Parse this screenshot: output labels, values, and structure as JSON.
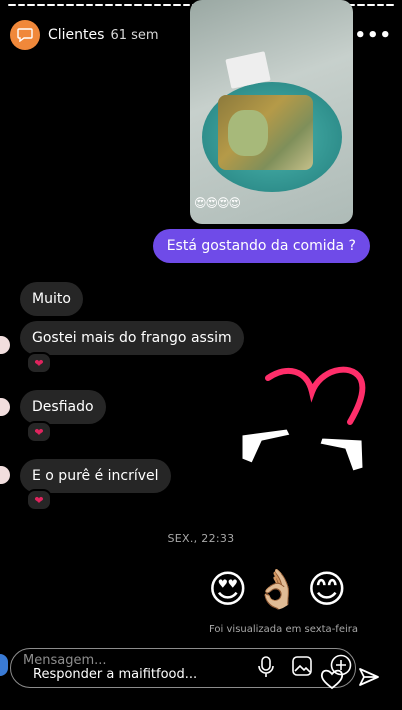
{
  "story": {
    "segments_total": 40,
    "segments_done": 40
  },
  "header": {
    "account": "Clientes",
    "time_ago": "61 sem",
    "avatar_icon": "chat-bubble-icon",
    "play_icon": "play-icon",
    "more_icon": "more-icon"
  },
  "photo": {
    "reactions": "😍😍😍😍"
  },
  "messages": {
    "outgoing_1": "Está gostando da comida ?",
    "in_1": "Muito",
    "in_2": "Gostei mais do frango assim",
    "in_3": "Desfiado",
    "in_4": "E o purê é incrível",
    "heart": "❤"
  },
  "timestamp": "SEX., 22:33",
  "emoji_reply": [
    "😍",
    "👌🏼",
    "😊"
  ],
  "seen": "Foi visualizada em sexta-feira",
  "composer": {
    "placeholder": "Mensagem...",
    "reply": "Responder a maifitfood..."
  },
  "colors": {
    "outgoing_bubble": "#6f4be8",
    "incoming_bubble": "#262626",
    "doodle": "#ff2e6a",
    "avatar": "#f0883a"
  }
}
